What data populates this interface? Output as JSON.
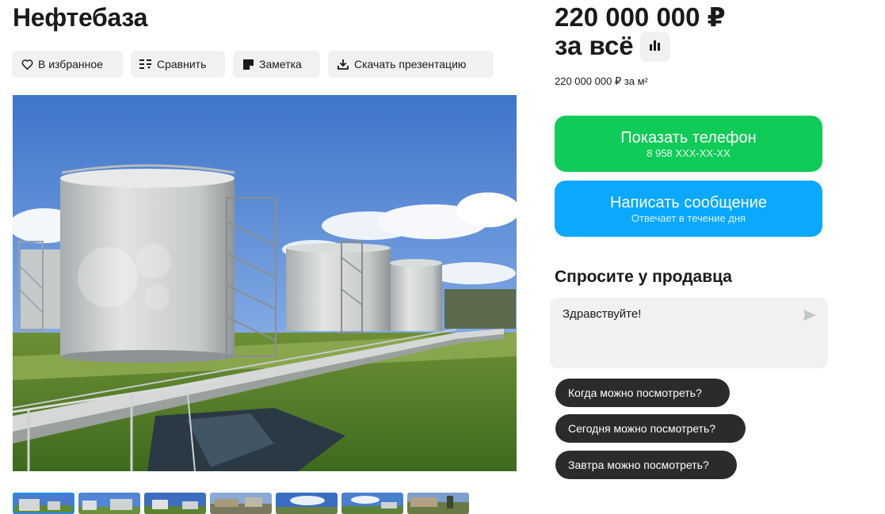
{
  "listing": {
    "title": "Нефтебаза"
  },
  "actions": {
    "favorite": "В избранное",
    "compare": "Сравнить",
    "note": "Заметка",
    "download": "Скачать презентацию"
  },
  "price": {
    "amount": "220 000 000 ₽",
    "suffix": "за всё",
    "per_m2": "220 000 000 ₽ за м²"
  },
  "contact": {
    "show_phone": "Показать телефон",
    "phone_masked": "8 958 XXX-XX-XX",
    "write_message": "Написать сообщение",
    "response_time": "Отвечает в течение дня"
  },
  "ask_seller": {
    "title": "Спросите у продавца",
    "message_value": "Здравствуйте!",
    "quick_questions": [
      "Когда можно посмотреть?",
      "Сегодня можно посмотреть?",
      "Завтра можно посмотреть?"
    ]
  },
  "gallery": {
    "active_index": 0,
    "thumb_count": 7
  },
  "colors": {
    "phone_button": "#0fcb57",
    "message_button": "#0ba8ff",
    "chip_bg": "#2b2b2b",
    "neutral_bg": "#f2f1f0"
  },
  "icons": {
    "favorite": "heart-icon",
    "compare": "compare-icon",
    "note": "note-icon",
    "download": "download-icon",
    "price_history": "bar-chart-icon",
    "send": "send-icon"
  }
}
